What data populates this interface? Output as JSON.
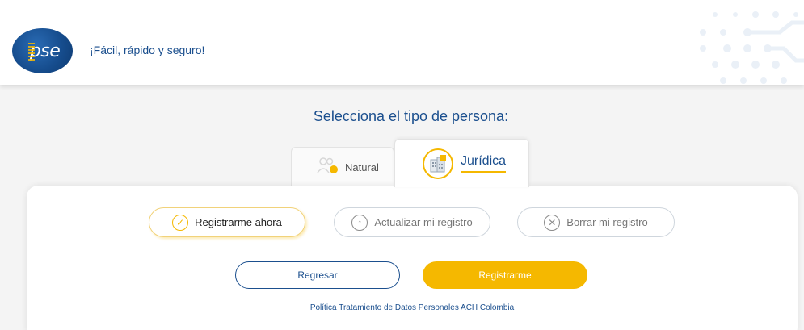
{
  "header": {
    "logo_text": "pse",
    "tagline": "¡Fácil, rápido y seguro!"
  },
  "main": {
    "title": "Selecciona el tipo de persona:",
    "tabs": [
      {
        "label": "Natural",
        "icon": "people-icon",
        "active": false
      },
      {
        "label": "Jurídica",
        "icon": "building-icon",
        "active": true
      }
    ],
    "options": [
      {
        "label": "Registrarme ahora",
        "icon": "check-circle-icon",
        "selected": true
      },
      {
        "label": "Actualizar mi registro",
        "icon": "arrow-up-circle-icon",
        "selected": false
      },
      {
        "label": "Borrar mi registro",
        "icon": "x-circle-icon",
        "selected": false
      }
    ],
    "back_label": "Regresar",
    "submit_label": "Registrarme",
    "policy_link": "Política Tratamiento de Datos Personales ACH Colombia"
  },
  "colors": {
    "brand_blue": "#1b4f8e",
    "accent_yellow": "#f5b800",
    "background": "#f4f4f4"
  }
}
